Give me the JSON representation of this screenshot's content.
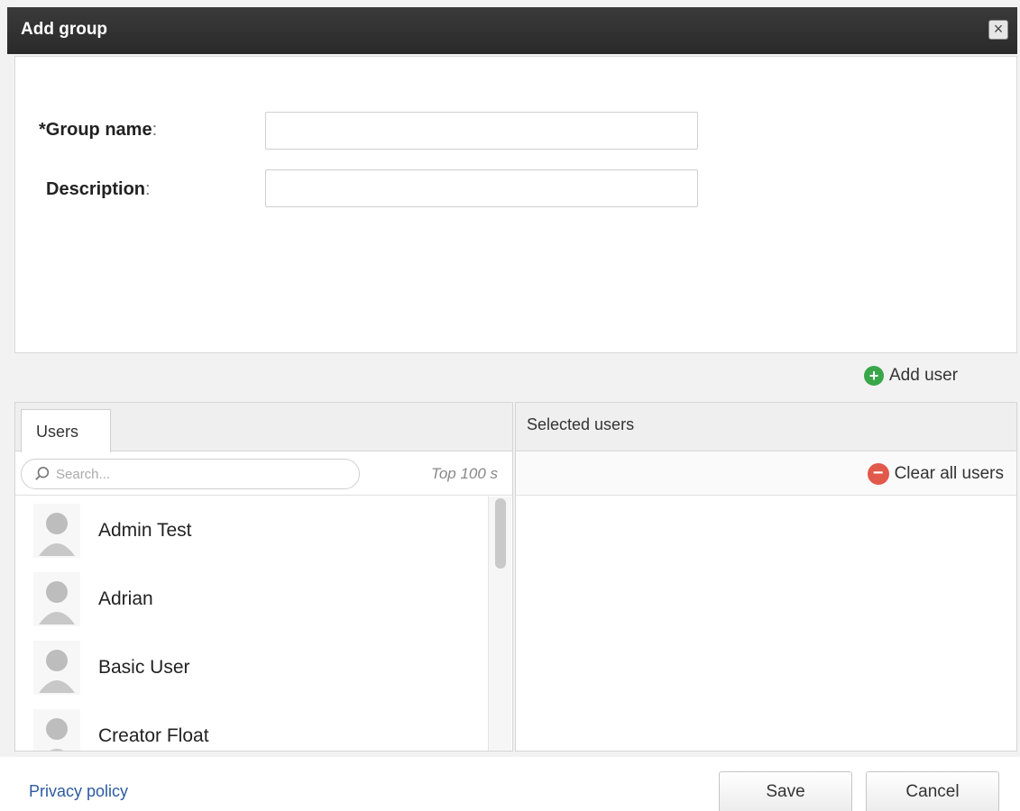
{
  "dialog": {
    "title": "Add group",
    "close_icon": "close-icon"
  },
  "form": {
    "group_name_label": "*Group name",
    "group_name_value": "",
    "description_label": "Description",
    "description_value": "",
    "colon": ":"
  },
  "actions": {
    "add_user_label": "Add user",
    "add_user_icon": "plus-circle-icon",
    "clear_all_label": "Clear all users",
    "clear_all_icon": "minus-circle-icon"
  },
  "users_pane": {
    "tab_label": "Users",
    "search_placeholder": "Search...",
    "top_label": "Top 100 s",
    "users": [
      {
        "name": "Admin Test"
      },
      {
        "name": "Adrian"
      },
      {
        "name": "Basic User"
      },
      {
        "name": "Creator Float"
      }
    ]
  },
  "selected_pane": {
    "header": "Selected users"
  },
  "footer": {
    "privacy_label": "Privacy policy",
    "save_label": "Save",
    "cancel_label": "Cancel"
  },
  "colors": {
    "titlebar": "#2f2f2f",
    "add_icon": "#3aa64a",
    "clear_icon": "#e2584a",
    "link": "#2c5aa0"
  }
}
